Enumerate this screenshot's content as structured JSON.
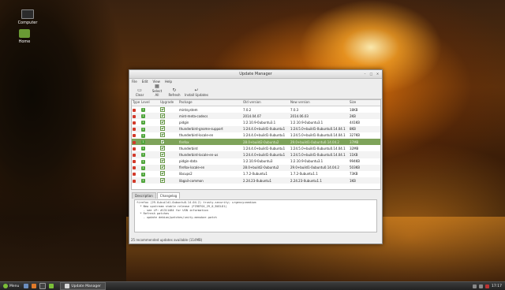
{
  "desktop": {
    "icons": [
      {
        "label": "Computer"
      },
      {
        "label": "Home"
      }
    ]
  },
  "window": {
    "title": "Update Manager",
    "menu": [
      "File",
      "Edit",
      "View",
      "Help"
    ],
    "toolbar": {
      "clear_label": "Clear",
      "select_all_label": "Select All",
      "refresh_label": "Refresh",
      "install_label": "Install Updates"
    },
    "columns": [
      "Type",
      "Level",
      "Upgrade",
      "Package",
      "Old version",
      "New version",
      "Size"
    ],
    "rows": [
      {
        "type": "red",
        "level": "1",
        "package": "mintsystem",
        "old": "7.0.2",
        "new": "7.0.3",
        "size": "18KB"
      },
      {
        "type": "red",
        "level": "1",
        "package": "mint-meta-codecs",
        "old": "2014.04.07",
        "new": "2014.06.03",
        "size": "2KB"
      },
      {
        "type": "red",
        "level": "1",
        "package": "pidgin",
        "old": "1:2.10.9-0ubuntu3.1",
        "new": "1:2.10.9-0ubuntu3.1",
        "size": "441KB"
      },
      {
        "type": "red",
        "level": "1",
        "package": "thunderbird-gnome-support",
        "old": "1:24.4.0+build1-0ubuntu1",
        "new": "1:24.5.0+build1-0ubuntu0.14.04.1",
        "size": "8KB"
      },
      {
        "type": "red",
        "level": "1",
        "package": "thunderbird-locale-en",
        "old": "1:24.4.0+build1-0ubuntu1",
        "new": "1:24.5.0+build1-0ubuntu0.14.04.1",
        "size": "327KB"
      },
      {
        "type": "red",
        "level": "1",
        "package": "firefox",
        "old": "28.0+build2-0ubuntu2",
        "new": "29.0+build1-0ubuntu0.14.04.2",
        "size": "37MB"
      },
      {
        "type": "red",
        "level": "1",
        "package": "thunderbird",
        "old": "1:24.4.0+build1-0ubuntu1",
        "new": "1:24.5.0+build1-0ubuntu0.14.04.1",
        "size": "32MB"
      },
      {
        "type": "red",
        "level": "1",
        "package": "thunderbird-locale-en-us",
        "old": "1:24.4.0+build1-0ubuntu1",
        "new": "1:24.5.0+build1-0ubuntu0.14.04.1",
        "size": "11KB"
      },
      {
        "type": "red",
        "level": "1",
        "package": "pidgin-data",
        "old": "1:2.10.9-0ubuntu3",
        "new": "1:2.10.9-0ubuntu3.1",
        "size": "994KB"
      },
      {
        "type": "red",
        "level": "1",
        "package": "firefox-locale-en",
        "old": "28.0+build2-0ubuntu2",
        "new": "29.0+build1-0ubuntu0.14.04.2",
        "size": "503KB"
      },
      {
        "type": "red",
        "level": "1",
        "package": "libcups2",
        "old": "1.7.2-0ubuntu1",
        "new": "1.7.2-0ubuntu1.1",
        "size": "73KB"
      },
      {
        "type": "red",
        "level": "1",
        "package": "libgail-common",
        "old": "2.24.23-0ubuntu1",
        "new": "2.24.23-0ubuntu1.1",
        "size": "1KB"
      }
    ],
    "selected_row": 5,
    "tabs": [
      "Description",
      "Changelog"
    ],
    "changelog": [
      "firefox (29.0+build1-0ubuntu0.14.04.2) trusty-security; urgency=medium",
      "",
      "  * New upstream stable release (FIREFOX_29_0_BUILD1)",
      "    - see LP: #1311484 for USN information",
      "",
      "  * Refresh patches",
      "    - update debian/patches/unity-menubar.patch"
    ],
    "status": "25 recommended updates available (114MB)"
  },
  "taskbar": {
    "menu_label": "Menu",
    "task_label": "Update Manager",
    "clock": "17:17"
  }
}
